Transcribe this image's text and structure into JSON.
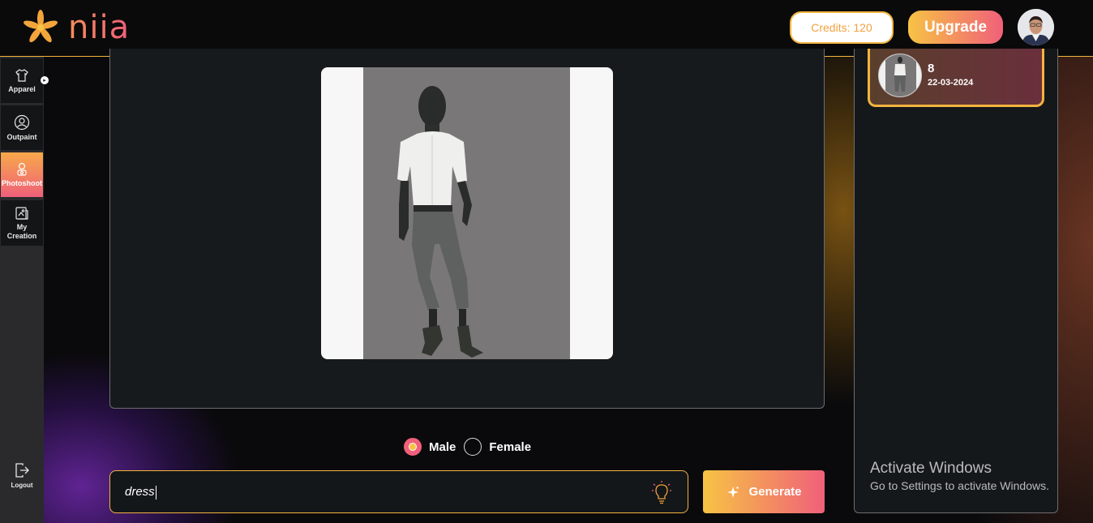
{
  "app": {
    "name": "niia"
  },
  "header": {
    "credits_label": "Credits: 120",
    "upgrade_label": "Upgrade"
  },
  "sidebar": {
    "items": [
      {
        "label": "Apparel",
        "icon": "shirt-icon",
        "active": false
      },
      {
        "label": "Outpaint",
        "icon": "user-circle-icon",
        "active": false
      },
      {
        "label": "Photoshoot",
        "icon": "camera-person-icon",
        "active": true
      },
      {
        "label": "My Creation",
        "icon": "gallery-icon",
        "active": false
      }
    ],
    "logout_label": "Logout"
  },
  "generator": {
    "gender_options": [
      {
        "label": "Male",
        "checked": true
      },
      {
        "label": "Female",
        "checked": false
      }
    ],
    "prompt_value": "dress",
    "generate_label": "Generate"
  },
  "history": {
    "items": [
      {
        "count": "8",
        "date": "22-03-2024"
      }
    ]
  },
  "watermark": {
    "title": "Activate Windows",
    "subtitle": "Go to Settings to activate Windows."
  },
  "colors": {
    "accent_yellow": "#f7c344",
    "accent_pink": "#f0607a",
    "border_gold": "#f3b43e"
  }
}
